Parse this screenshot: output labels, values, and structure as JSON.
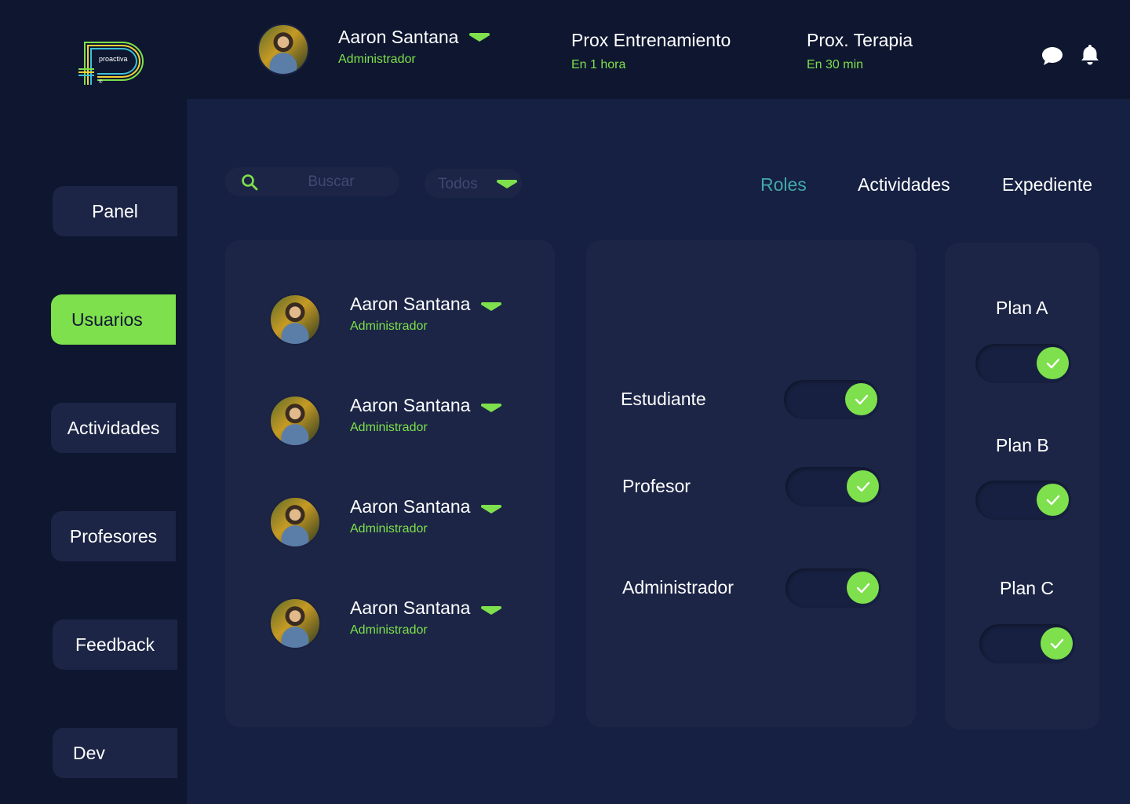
{
  "header": {
    "logo_text": "proactiva",
    "user": {
      "name": "Aaron Santana",
      "role": "Administrador"
    },
    "upcoming": [
      {
        "label": "Prox Entrenamiento",
        "time": "En 1 hora"
      },
      {
        "label": "Prox. Terapia",
        "time": "En 30 min"
      }
    ],
    "icons": [
      "chat-icon",
      "bell-icon"
    ]
  },
  "sidebar": {
    "items": [
      {
        "label": "Panel",
        "active": false
      },
      {
        "label": "Usuarios",
        "active": true
      },
      {
        "label": "Actividades",
        "active": false
      },
      {
        "label": "Profesores",
        "active": false
      },
      {
        "label": "Feedback",
        "active": false
      },
      {
        "label": "Dev",
        "active": false
      }
    ]
  },
  "toolbar": {
    "search_placeholder": "Buscar",
    "filter_value": "Todos"
  },
  "tabs": [
    {
      "label": "Roles",
      "active": true
    },
    {
      "label": "Actividades",
      "active": false
    },
    {
      "label": "Expediente",
      "active": false
    }
  ],
  "users": [
    {
      "name": "Aaron Santana",
      "role": "Administrador"
    },
    {
      "name": "Aaron Santana",
      "role": "Administrador"
    },
    {
      "name": "Aaron Santana",
      "role": "Administrador"
    },
    {
      "name": "Aaron Santana",
      "role": "Administrador"
    }
  ],
  "roles": [
    {
      "label": "Estudiante",
      "enabled": true
    },
    {
      "label": "Profesor",
      "enabled": true
    },
    {
      "label": "Administrador",
      "enabled": true
    }
  ],
  "plans": [
    {
      "label": "Plan A",
      "enabled": true
    },
    {
      "label": "Plan B",
      "enabled": true
    },
    {
      "label": "Plan C",
      "enabled": true
    }
  ],
  "colors": {
    "background": "#0e1630",
    "panel": "#1c2546",
    "accent": "#7ee04c",
    "active_tab": "#44a8a8"
  }
}
